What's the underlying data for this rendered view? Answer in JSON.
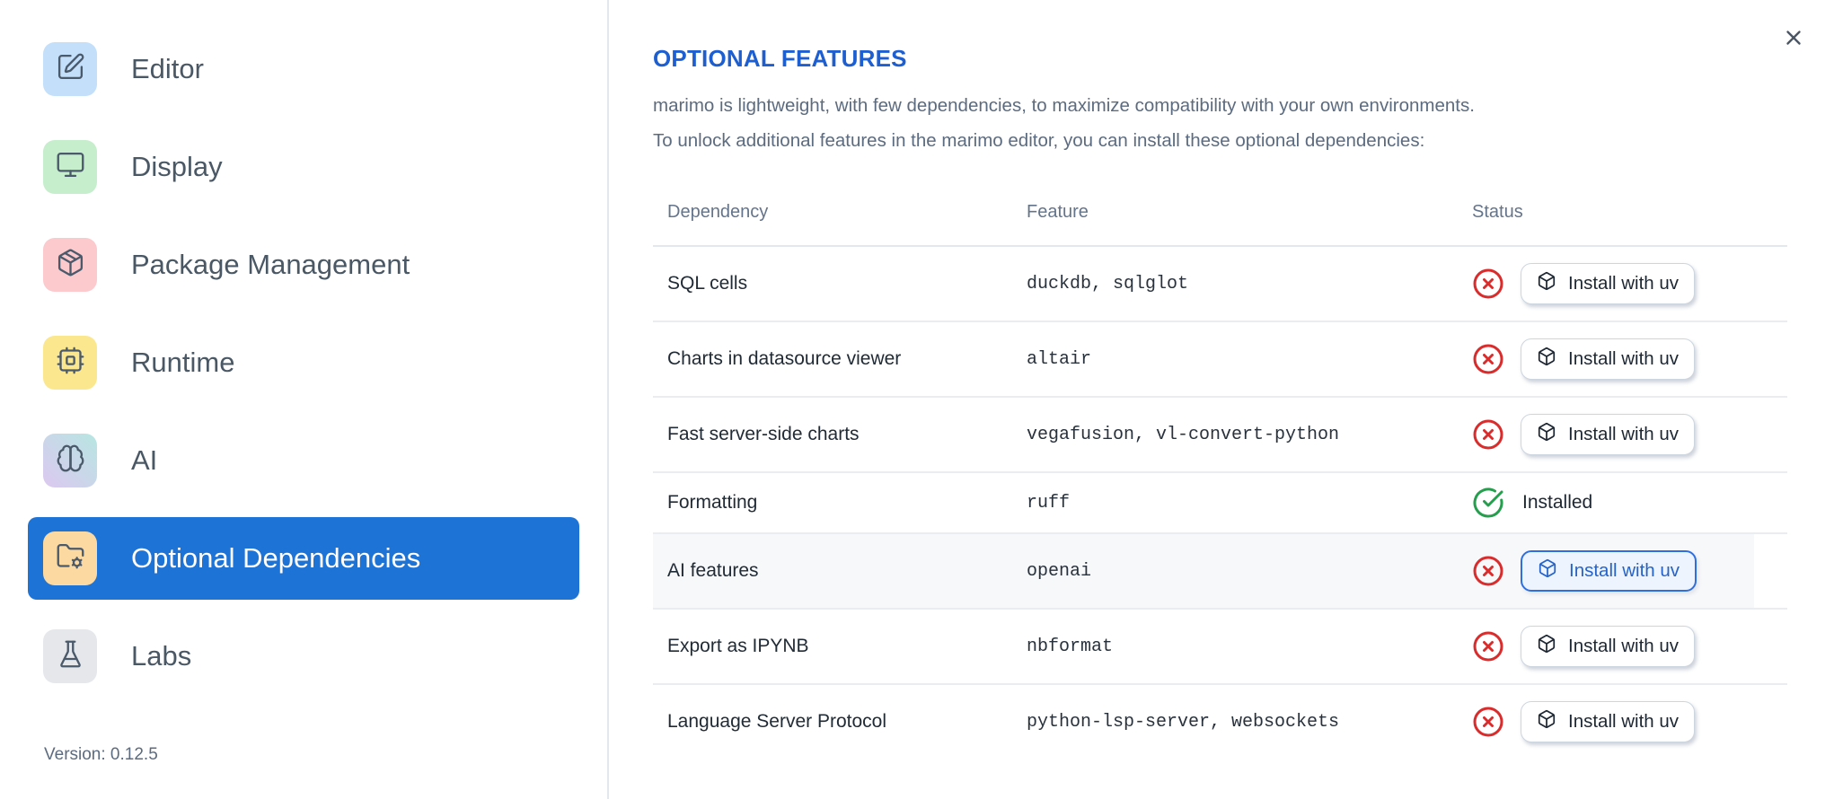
{
  "colors": {
    "selected_item_blue": "#1e73d7",
    "title_blue": "#1d5fd0",
    "error_red": "#d92d2d",
    "success_green": "#259e4d"
  },
  "sidebar": {
    "items": [
      {
        "name": "editor",
        "label": "Editor",
        "icon": "square-pen-icon",
        "tile_bg": "#c3dff9",
        "selected": false
      },
      {
        "name": "display",
        "label": "Display",
        "icon": "monitor-icon",
        "tile_bg": "#c6edcc",
        "selected": false
      },
      {
        "name": "package-management",
        "label": "Package Management",
        "icon": "package-icon",
        "tile_bg": "#fcc9cd",
        "selected": false
      },
      {
        "name": "runtime",
        "label": "Runtime",
        "icon": "cpu-icon",
        "tile_bg": "#fbe78e",
        "selected": false
      },
      {
        "name": "ai",
        "label": "AI",
        "icon": "brain-icon",
        "tile_bg": "linear-gradient(to top right, #dcc8f0, #b7e6e2)",
        "selected": false
      },
      {
        "name": "optional-dependencies",
        "label": "Optional Dependencies",
        "icon": "folder-cog-icon",
        "tile_bg": "#fcd9a0",
        "selected": true
      },
      {
        "name": "labs",
        "label": "Labs",
        "icon": "flask-icon",
        "tile_bg": "#e5e7eb",
        "selected": false
      }
    ],
    "version_label": "Version: 0.12.5"
  },
  "dialog": {
    "title": "OPTIONAL FEATURES",
    "description_line1": "marimo is lightweight, with few dependencies, to maximize compatibility with your own environments.",
    "description_line2": "To unlock additional features in the marimo editor, you can install these optional dependencies:",
    "close_icon": "close-icon",
    "table": {
      "headers": [
        "Dependency",
        "Feature",
        "Status"
      ],
      "status_icons": {
        "missing": "circle-x-icon",
        "installed": "circle-check-icon"
      },
      "button_icon": "box-icon",
      "rows": [
        {
          "dependency": "SQL cells",
          "feature": "duckdb, sqlglot",
          "installed": false,
          "action": "Install with uv",
          "highlighted": false
        },
        {
          "dependency": "Charts in datasource viewer",
          "feature": "altair",
          "installed": false,
          "action": "Install with uv",
          "highlighted": false
        },
        {
          "dependency": "Fast server-side charts",
          "feature": "vegafusion, vl-convert-python",
          "installed": false,
          "action": "Install with uv",
          "highlighted": false
        },
        {
          "dependency": "Formatting",
          "feature": "ruff",
          "installed": true,
          "status_label": "Installed",
          "highlighted": false
        },
        {
          "dependency": "AI features",
          "feature": "openai",
          "installed": false,
          "action": "Install with uv",
          "highlighted": true
        },
        {
          "dependency": "Export as IPYNB",
          "feature": "nbformat",
          "installed": false,
          "action": "Install with uv",
          "highlighted": false
        },
        {
          "dependency": "Language Server Protocol",
          "feature": "python-lsp-server, websockets",
          "installed": false,
          "action": "Install with uv",
          "highlighted": false
        }
      ]
    }
  }
}
